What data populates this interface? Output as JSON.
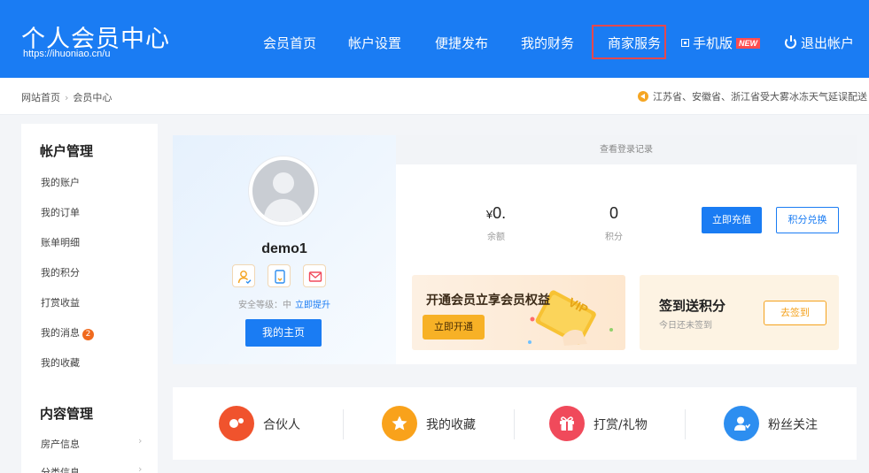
{
  "header": {
    "site_title": "个人会员中心",
    "site_url": "https://ihuoniao.cn/u",
    "nav": {
      "home": "会员首页",
      "account_settings": "帐户设置",
      "quick_publish": "便捷发布",
      "finance": "我的财务",
      "merchant": "商家服务",
      "mobile": "手机版",
      "new_badge": "NEW",
      "logout": "退出帐户"
    },
    "highlight_color": "#e5484d"
  },
  "breadcrumb": {
    "site_home": "网站首页",
    "separator": "›",
    "current": "会员中心"
  },
  "notice": "江苏省、安徽省、浙江省受大雾冰冻天气延误配送",
  "sidebar": {
    "account_heading": "帐户管理",
    "account_items": [
      "我的账户",
      "我的订单",
      "账单明细",
      "我的积分",
      "打赏收益",
      "我的消息",
      "我的收藏"
    ],
    "message_badge": "2",
    "content_heading": "内容管理",
    "content_items": [
      "房产信息",
      "分类信息"
    ],
    "chevron": "›"
  },
  "profile": {
    "username": "demo1",
    "security_label": "安全等级：中",
    "security_upgrade": "立即提升",
    "home_button": "我的主页"
  },
  "stats": {
    "login_log": "查看登录记录",
    "balance_value": "0.",
    "balance_prefix": "¥",
    "balance_label": "余额",
    "points_value": "0",
    "points_label": "积分",
    "recharge_button": "立即充值",
    "exchange_button": "积分兑换"
  },
  "vip": {
    "title": "开通会员立享会员权益",
    "button": "立即开通",
    "card_text": "VIP"
  },
  "signin": {
    "title": "签到送积分",
    "status": "今日还未签到",
    "button": "去签到"
  },
  "shortcuts": [
    {
      "label": "合伙人",
      "color": "#f0532d"
    },
    {
      "label": "我的收藏",
      "color": "#f9a21b"
    },
    {
      "label": "打赏/礼物",
      "color": "#f04a5b"
    },
    {
      "label": "粉丝关注",
      "color": "#2d8ef0"
    }
  ],
  "colors": {
    "primary": "#1a7cf3",
    "vip_gold": "#f7b126",
    "sign_orange": "#f4a21d"
  }
}
